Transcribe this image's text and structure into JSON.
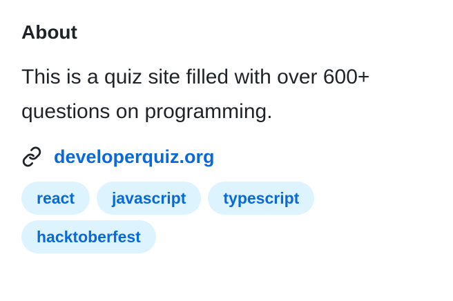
{
  "about": {
    "heading": "About",
    "description": "This is a quiz site filled with over 600+ questions on programming.",
    "website": {
      "icon": "link-icon",
      "label": "developerquiz.org"
    },
    "topics": [
      "react",
      "javascript",
      "typescript",
      "hacktoberfest"
    ]
  },
  "colors": {
    "text": "#1f2328",
    "link": "#0969da",
    "topic_background": "#ddf4ff"
  }
}
